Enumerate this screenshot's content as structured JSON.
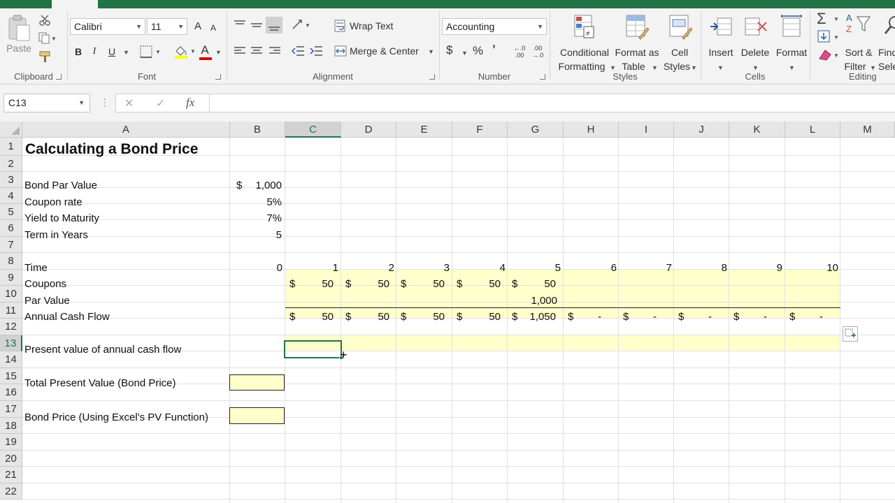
{
  "ribbon": {
    "clipboard": {
      "label": "Clipboard",
      "paste": "Paste"
    },
    "font": {
      "label": "Font",
      "name": "Calibri",
      "size": "11",
      "bold": "B",
      "italic": "I",
      "underline": "U",
      "font_color": "A",
      "grow": "A",
      "shrink": "A"
    },
    "alignment": {
      "label": "Alignment",
      "wrap_text": "Wrap Text",
      "merge_center": "Merge & Center"
    },
    "number": {
      "label": "Number",
      "format": "Accounting",
      "currency": "$",
      "percent": "%",
      "comma": "’",
      "inc_decimal": "←.0\n.00",
      "dec_decimal": ".00\n→.0"
    },
    "styles": {
      "label": "Styles",
      "conditional_1": "Conditional",
      "conditional_2": "Formatting",
      "format_table_1": "Format as",
      "format_table_2": "Table",
      "cell_styles_1": "Cell",
      "cell_styles_2": "Styles"
    },
    "cells": {
      "label": "Cells",
      "insert": "Insert",
      "delete": "Delete",
      "format": "Format"
    },
    "editing": {
      "label": "Editing",
      "sort_1": "Sort &",
      "sort_2": "Filter",
      "find_1": "Find",
      "find_2": "Select"
    }
  },
  "formula_bar": {
    "name_box": "C13",
    "cancel": "✕",
    "enter": "✓",
    "fx": "fx",
    "content": ""
  },
  "columns": [
    "A",
    "B",
    "C",
    "D",
    "E",
    "F",
    "G",
    "H",
    "I",
    "J",
    "K",
    "L",
    "M"
  ],
  "rows": [
    "1",
    "2",
    "3",
    "4",
    "5",
    "6",
    "7",
    "8",
    "9",
    "10",
    "11",
    "12",
    "13",
    "14",
    "15",
    "16",
    "17",
    "18",
    "19",
    "20",
    "21",
    "22"
  ],
  "sheet": {
    "title": "Calculating a Bond Price",
    "par_value_label": "Bond Par Value",
    "par_value_sym": "$",
    "par_value": "1,000",
    "coupon_rate_label": "Coupon rate",
    "coupon_rate": "5%",
    "ytm_label": "Yield to Maturity",
    "ytm": "7%",
    "term_label": "Term in Years",
    "term": "5",
    "time_label": "Time",
    "time_values": [
      "0",
      "1",
      "2",
      "3",
      "4",
      "5",
      "6",
      "7",
      "8",
      "9",
      "10"
    ],
    "coupons_label": "Coupons",
    "coupons": [
      "50",
      "50",
      "50",
      "50",
      "50"
    ],
    "par_label": "Par Value",
    "par_row_value": "1,000",
    "cashflow_label": "Annual Cash Flow",
    "cashflows": [
      "50",
      "50",
      "50",
      "50",
      "1,050",
      "-",
      "-",
      "-",
      "-",
      "-"
    ],
    "currency_sym": "$",
    "pv_label": "Present value of annual cash flow",
    "total_pv_label": "Total Present Value (Bond Price)",
    "pv_function_label": "Bond Price (Using Excel's PV Function)"
  }
}
